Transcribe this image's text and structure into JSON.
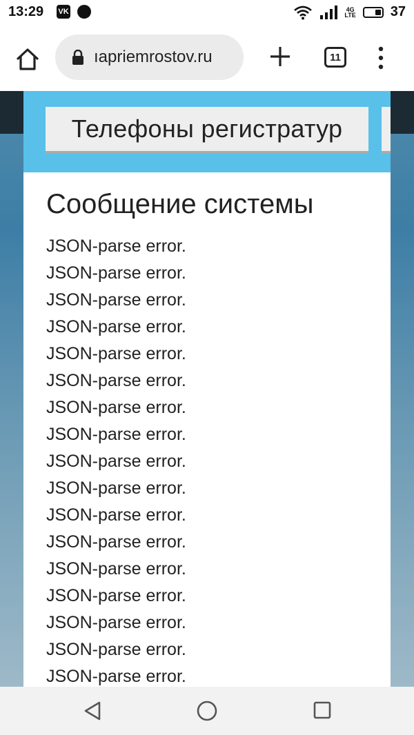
{
  "status_bar": {
    "time": "13:29",
    "vk_label": "VK",
    "lte_top": "4G",
    "lte_bottom": "LTE",
    "battery": "37",
    "icons": [
      "vk-icon",
      "whatsapp-icon",
      "wifi-icon",
      "signal-icon",
      "battery-icon"
    ]
  },
  "browser": {
    "url": "ıapriemrostov.ru",
    "tab_count": "11",
    "icons": [
      "home-icon",
      "lock-icon",
      "plus-icon",
      "tabs-icon",
      "more-vert-icon"
    ]
  },
  "page": {
    "phones_button": "Телефоны регистратур",
    "title": "Сообщение системы",
    "errors": [
      "JSON-parse error.",
      "JSON-parse error.",
      "JSON-parse error.",
      "JSON-parse error.",
      "JSON-parse error.",
      "JSON-parse error.",
      "JSON-parse error.",
      "JSON-parse error.",
      "JSON-parse error.",
      "JSON-parse error.",
      "JSON-parse error.",
      "JSON-parse error.",
      "JSON-parse error.",
      "JSON-parse error.",
      "JSON-parse error.",
      "JSON-parse error.",
      "JSON-parse error."
    ]
  },
  "colors": {
    "panel_accent": "#58c0e9",
    "dark_strip": "#1b2a33"
  },
  "navbar": {
    "icons": [
      "back-icon",
      "home-circle-icon",
      "recent-apps-icon"
    ]
  }
}
